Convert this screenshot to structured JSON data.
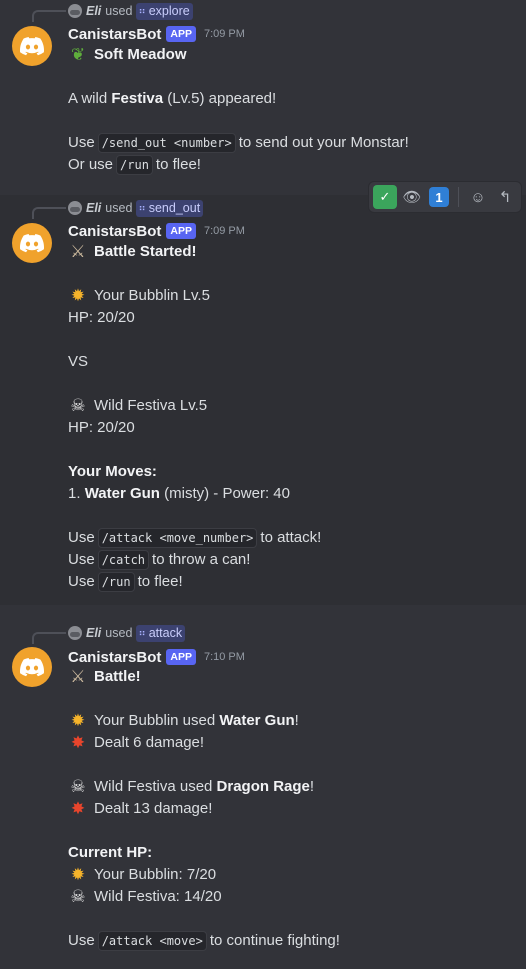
{
  "messages": [
    {
      "reply": {
        "user": "Eli",
        "used": "used",
        "command": "explore"
      },
      "author": "CanistarsBot",
      "tag": "APP",
      "time": "7:09 PM",
      "title": "Soft Meadow",
      "lines": {
        "appeared_pre": "A wild",
        "appeared_name": "Festiva",
        "appeared_post": "(Lv.5) appeared!",
        "use1_pre": "Use",
        "use1_code": "/send_out <number>",
        "use1_post": "to send out your Monstar!",
        "use2_pre": "Or use",
        "use2_code": "/run",
        "use2_post": "to flee!"
      }
    },
    {
      "reply": {
        "user": "Eli",
        "used": "used",
        "command": "send_out"
      },
      "author": "CanistarsBot",
      "tag": "APP",
      "time": "7:09 PM",
      "title": "Battle Started!",
      "lines": {
        "your": "Your Bubblin Lv.5",
        "your_hp": "HP: 20/20",
        "vs": "VS",
        "wild": "Wild Festiva Lv.5",
        "wild_hp": "HP: 20/20",
        "moves_header": "Your Moves:",
        "move1_num": "1.",
        "move1_name": "Water Gun",
        "move1_rest": "(misty) - Power: 40",
        "atk_pre": "Use",
        "atk_code": "/attack <move_number>",
        "atk_post": "to attack!",
        "catch_pre": "Use",
        "catch_code": "/catch",
        "catch_post": "to throw a can!",
        "run_pre": "Use",
        "run_code": "/run",
        "run_post": "to flee!"
      }
    },
    {
      "reply": {
        "user": "Eli",
        "used": "used",
        "command": "attack"
      },
      "author": "CanistarsBot",
      "tag": "APP",
      "time": "7:10 PM",
      "title": "Battle!",
      "lines": {
        "p_used_pre": "Your Bubblin used",
        "p_used_move": "Water Gun",
        "p_used_post": "!",
        "p_dealt": "Dealt 6 damage!",
        "w_used_pre": "Wild Festiva used",
        "w_used_move": "Dragon Rage",
        "w_used_post": "!",
        "w_dealt": "Dealt 13 damage!",
        "hp_header": "Current HP:",
        "hp_player": "Your Bubblin: 7/20",
        "hp_wild": "Wild Festiva: 14/20",
        "cont_pre": "Use",
        "cont_code": "/attack <move>",
        "cont_post": "to continue fighting!"
      }
    }
  ],
  "toolbar": {
    "reaction_count": "1",
    "icons": [
      "check-mark-reaction",
      "eyes-reaction",
      "number-one-reaction",
      "add-reaction-icon",
      "reply-icon"
    ]
  },
  "colors": {
    "background": "#323339",
    "hover_background": "#2e2f34",
    "app_tag": "#5865f2",
    "avatar": "#f0a22c",
    "command_pill": "#3c4270"
  }
}
